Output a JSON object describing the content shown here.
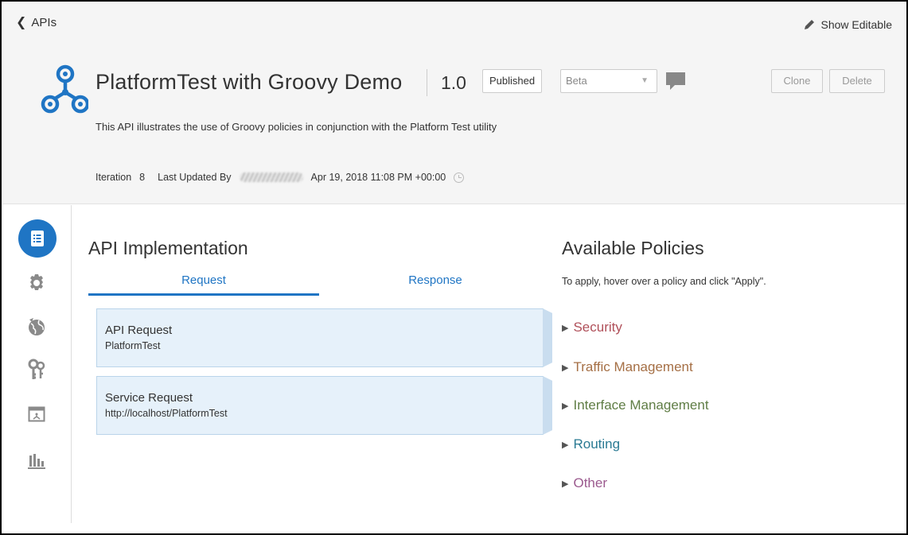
{
  "topbar": {
    "back_label": "APIs",
    "show_editable_label": "Show Editable"
  },
  "header": {
    "title": "PlatformTest with Groovy Demo",
    "version": "1.0",
    "status_label": "Published",
    "stage_value": "Beta",
    "clone_label": "Clone",
    "delete_label": "Delete",
    "description": "This API illustrates the use of Groovy policies in conjunction with the Platform Test utility",
    "iteration_label": "Iteration",
    "iteration_value": "8",
    "last_updated_label": "Last Updated By",
    "last_updated_date": "Apr 19, 2018 11:08 PM +00:00"
  },
  "nav": {
    "items": [
      "implementation-icon",
      "settings-icon",
      "globe-icon",
      "keys-icon",
      "deployment-icon",
      "analytics-icon"
    ]
  },
  "implementation": {
    "title": "API Implementation",
    "tabs": [
      "Request",
      "Response"
    ],
    "cards": [
      {
        "title": "API Request",
        "subtitle": "PlatformTest"
      },
      {
        "title": "Service Request",
        "subtitle": "http://localhost/PlatformTest"
      }
    ]
  },
  "policies": {
    "title": "Available Policies",
    "hint": "To apply, hover over a policy and click \"Apply\".",
    "groups": [
      {
        "label": "Security",
        "color": "#b0505a"
      },
      {
        "label": "Traffic Management",
        "color": "#a56f45"
      },
      {
        "label": "Interface Management",
        "color": "#5f7d45"
      },
      {
        "label": "Routing",
        "color": "#2a7a93"
      },
      {
        "label": "Other",
        "color": "#9b5a8e"
      }
    ]
  },
  "colors": {
    "accent": "#1f75c4",
    "header_bg": "#f5f5f5",
    "card_bg": "#e6f1fa"
  }
}
